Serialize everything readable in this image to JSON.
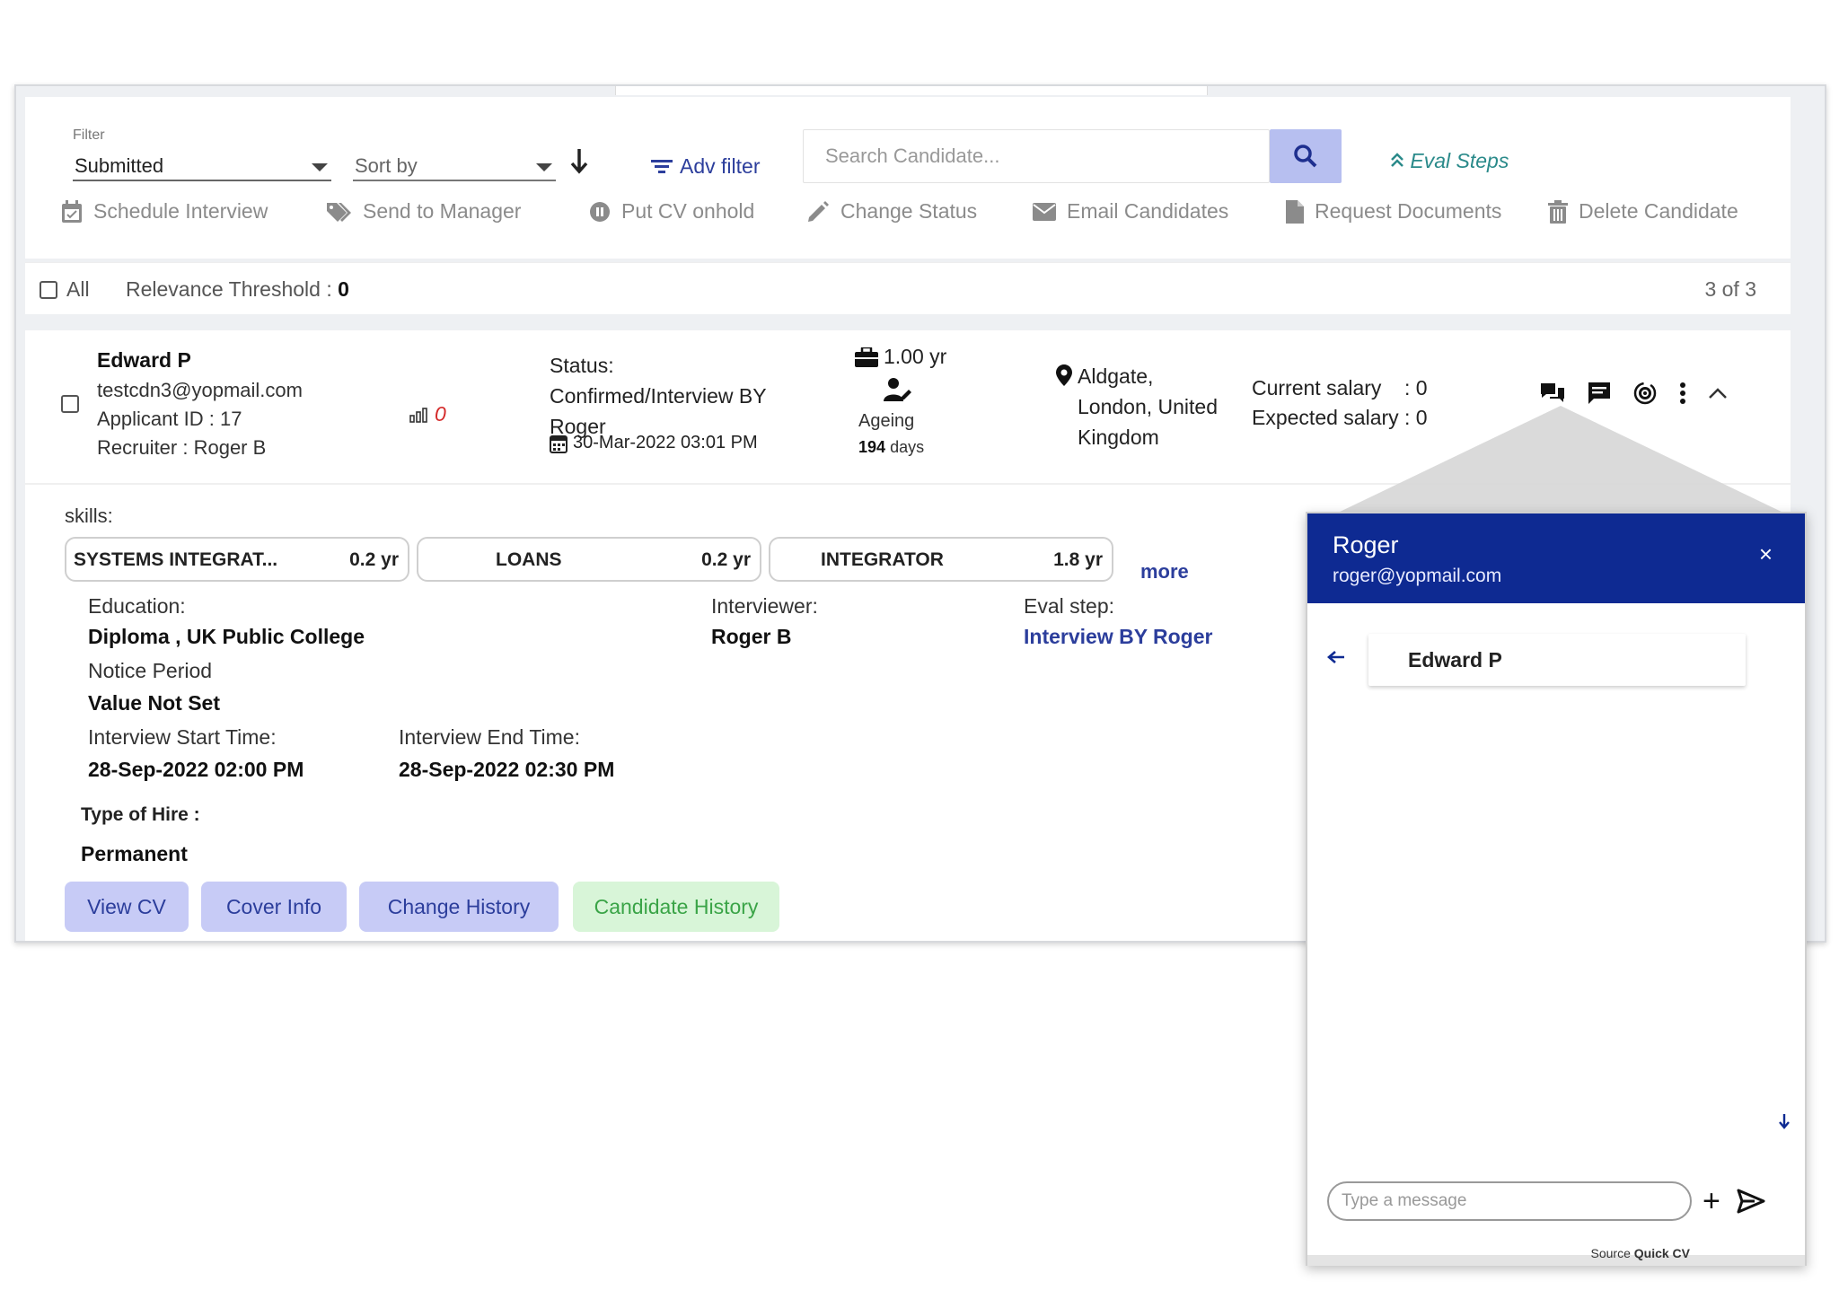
{
  "toolbar": {
    "filter_label": "Filter",
    "filter_value": "Submitted",
    "sort_placeholder": "Sort by",
    "adv_filter": "Adv filter",
    "search_placeholder": "Search Candidate...",
    "eval_steps": "Eval Steps"
  },
  "actions": [
    {
      "label": "Schedule Interview",
      "icon": "calendar-icon"
    },
    {
      "label": "Send to Manager",
      "icon": "tag-icon"
    },
    {
      "label": "Put CV onhold",
      "icon": "pause-icon"
    },
    {
      "label": "Change Status",
      "icon": "pencil-icon"
    },
    {
      "label": "Email Candidates",
      "icon": "envelope-icon"
    },
    {
      "label": "Request Documents",
      "icon": "document-icon"
    },
    {
      "label": "Delete Candidate",
      "icon": "trash-icon"
    }
  ],
  "list": {
    "all_label": "All",
    "relevance_label": "Relevance Threshold : ",
    "relevance_value": "0",
    "count": "3 of 3"
  },
  "candidate": {
    "name": "Edward P",
    "email": "testcdn3@yopmail.com",
    "applicant_id": "Applicant ID : 17",
    "recruiter": "Recruiter : Roger B",
    "relevance_score": "0",
    "status_label": "Status:",
    "status_line1": "Confirmed/Interview BY",
    "status_line2": "Roger",
    "status_date": "30-Mar-2022 03:01 PM",
    "experience": "1.00 yr",
    "ageing_label": "Ageing",
    "ageing_days": "194",
    "ageing_unit": "days",
    "location_line1": "Aldgate,",
    "location_line2": "London, United",
    "location_line3": "Kingdom",
    "current_salary": "Current salary    : 0",
    "expected_salary": "Expected salary : 0",
    "skills_label": "skills:",
    "skills": [
      {
        "name": "SYSTEMS INTEGRAT...",
        "years": "0.2 yr"
      },
      {
        "name": "LOANS",
        "years": "0.2 yr"
      },
      {
        "name": "INTEGRATOR",
        "years": "1.8 yr"
      }
    ],
    "more": "more",
    "education_label": "Education:",
    "education_value": "Diploma , UK Public College",
    "interviewer_label": "Interviewer:",
    "interviewer_value": "Roger B",
    "eval_step_label": "Eval step:",
    "eval_step_value": "Interview BY Roger",
    "notice_label": "Notice Period",
    "notice_value": "Value Not Set",
    "start_label": "Interview Start Time:",
    "start_value": "28-Sep-2022 02:00 PM",
    "end_label": "Interview End Time:",
    "end_value": "28-Sep-2022 02:30 PM",
    "hire_label": "Type of Hire :",
    "hire_value": "Permanent",
    "buttons": {
      "view_cv": "View CV",
      "cover_info": "Cover Info",
      "change_history": "Change History",
      "candidate_history": "Candidate History"
    }
  },
  "chat": {
    "name": "Roger",
    "email": "roger@yopmail.com",
    "close": "×",
    "contact": "Edward P",
    "input_placeholder": "Type a message",
    "plus": "+",
    "footer_source": "Source",
    "footer_value": "Quick CV"
  },
  "colors": {
    "primary": "#2c3e9c",
    "chat_header": "#0e2a92",
    "button_bg": "#c7cbf6",
    "green_button_bg": "#d8f5d8",
    "green_text": "#3aa447",
    "eval_steps": "#2a8a8a",
    "relevance": "#d42a2a"
  }
}
